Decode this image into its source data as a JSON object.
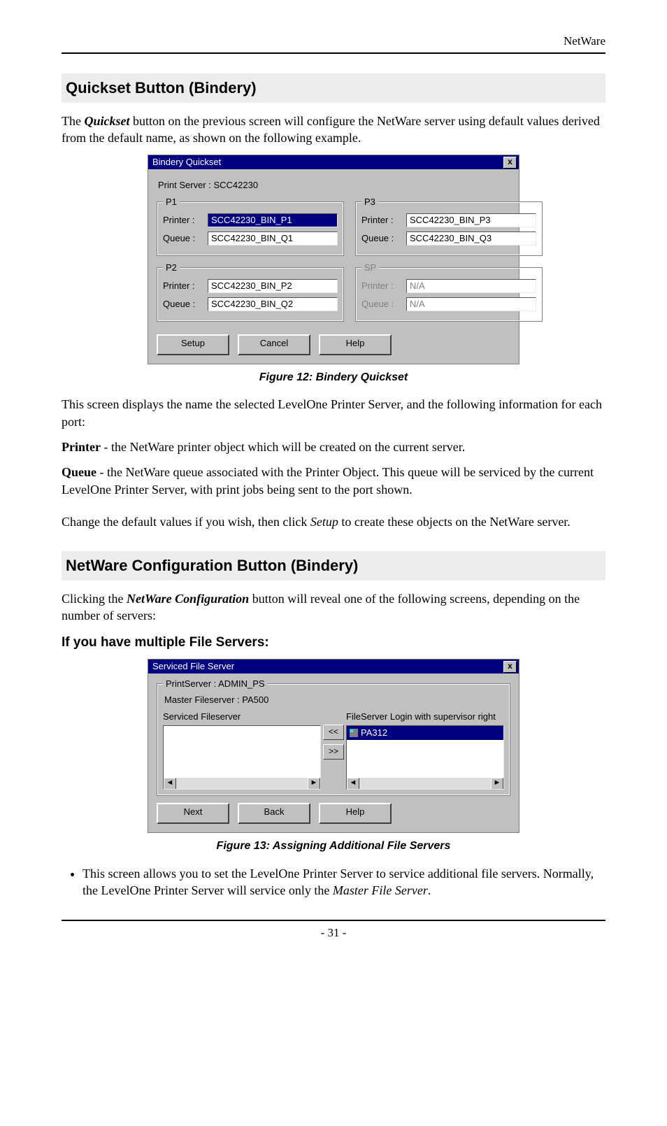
{
  "header": {
    "right": "NetWare"
  },
  "section1": {
    "heading": "Quickset Button (Bindery)",
    "para1a": "The ",
    "para1b_bi": "Quickset",
    "para1c": " button on the previous screen will configure the NetWare server using default values derived from the default name, as shown on the following example."
  },
  "dialog1": {
    "title": "Bindery Quickset",
    "close": "x",
    "print_server_line": "Print Server : SCC42230",
    "groups": {
      "P1": {
        "legend": "P1",
        "printer_label": "Printer :",
        "printer_value": "SCC42230_BIN_P1",
        "queue_label": "Queue :",
        "queue_value": "SCC42230_BIN_Q1"
      },
      "P3": {
        "legend": "P3",
        "printer_label": "Printer :",
        "printer_value": "SCC42230_BIN_P3",
        "queue_label": "Queue :",
        "queue_value": "SCC42230_BIN_Q3"
      },
      "P2": {
        "legend": "P2",
        "printer_label": "Printer :",
        "printer_value": "SCC42230_BIN_P2",
        "queue_label": "Queue :",
        "queue_value": "SCC42230_BIN_Q2"
      },
      "SP": {
        "legend": "SP",
        "printer_label": "Printer :",
        "printer_value": "N/A",
        "queue_label": "Queue :",
        "queue_value": "N/A"
      }
    },
    "buttons": {
      "setup": "Setup",
      "cancel": "Cancel",
      "help": "Help"
    }
  },
  "caption1": "Figure 12: Bindery Quickset",
  "para2": "This screen displays the name the selected LevelOne Printer Server, and the following information for each port:",
  "para3": {
    "bold": "Printer",
    "rest": " - the NetWare printer object which will be created on the current server."
  },
  "para4": {
    "bold": "Queue",
    "rest": " - the NetWare queue associated with the Printer Object. This queue will be serviced by the current LevelOne Printer Server, with print jobs being sent to the port shown."
  },
  "para5": {
    "a": "Change the default values if you wish, then click ",
    "i": "Setup",
    "b": " to create these objects on the NetWare server."
  },
  "section2": {
    "heading": "NetWare Configuration Button (Bindery)",
    "para": {
      "a": "Clicking the ",
      "bi": "NetWare Configuration",
      "b": " button will reveal one of the following screens, depending on the number of servers:"
    },
    "subhead": "If you have multiple File Servers:"
  },
  "dialog2": {
    "title": "Serviced File Server",
    "close": "x",
    "group_legend": "PrintServer : ADMIN_PS",
    "master_line": "Master Fileserver : PA500",
    "left_label": "Serviced Fileserver",
    "right_label": "FileServer Login with supervisor right",
    "right_item": "PA312",
    "left_arrow": "<<",
    "right_arrow": ">>",
    "scroll_left": "◄",
    "scroll_right": "►",
    "buttons": {
      "next": "Next",
      "back": "Back",
      "help": "Help"
    }
  },
  "caption2": "Figure 13: Assigning Additional File Servers",
  "bullet1": {
    "a": "This screen allows you to set the LevelOne Printer Server to service additional file servers. Normally, the LevelOne Printer Server will service only the ",
    "i": "Master File Server",
    "b": "."
  },
  "footer": {
    "pagenum": "- 31 -"
  }
}
